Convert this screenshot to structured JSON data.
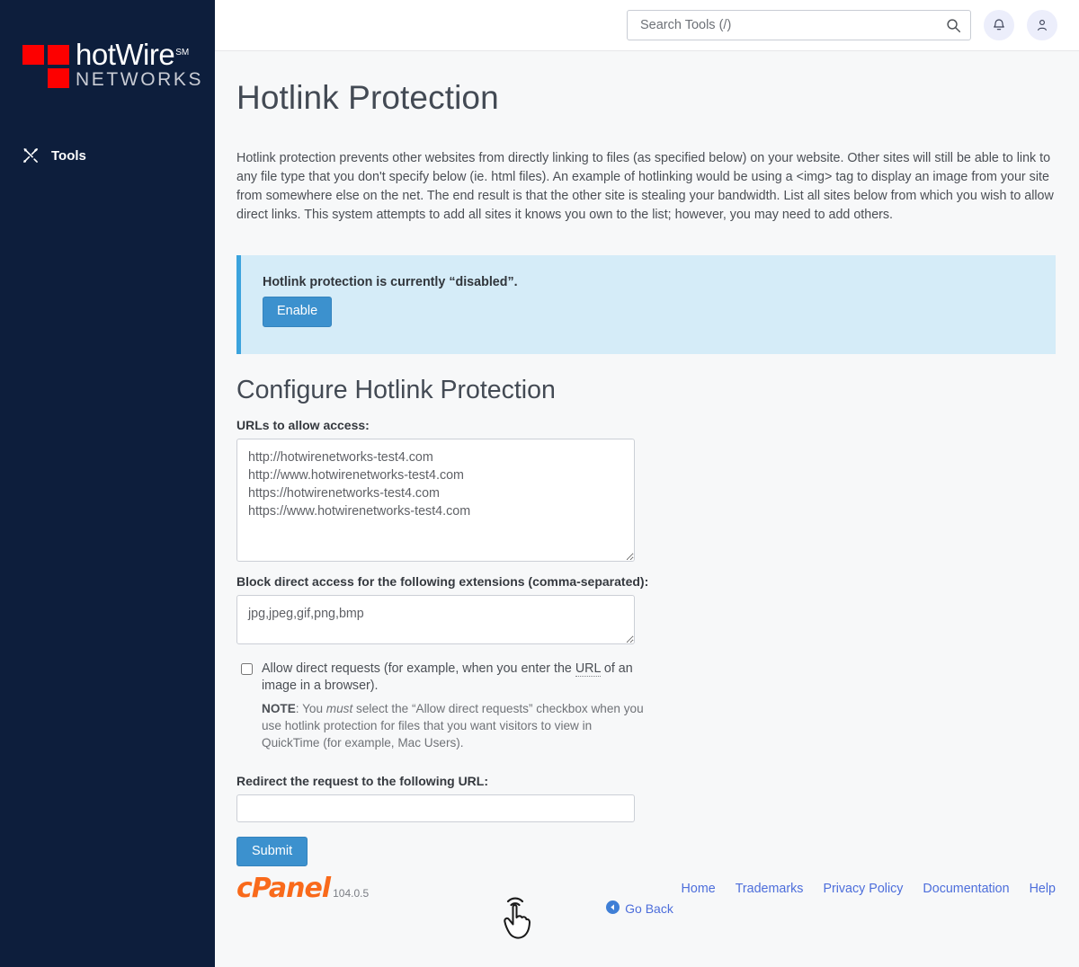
{
  "sidebar": {
    "logo": {
      "line1": "hotWire",
      "superscript": "SM",
      "line2": "NETWORKS",
      "square_color": "#fd0000",
      "background": "#0d1e3c"
    },
    "nav": [
      {
        "label": "Tools",
        "icon": "tools-icon"
      }
    ]
  },
  "topbar": {
    "search": {
      "placeholder": "Search Tools (/)",
      "value": "",
      "icon": "search-icon"
    },
    "notifications_icon": "bell-icon",
    "account_icon": "user-icon"
  },
  "page": {
    "title": "Hotlink Protection",
    "intro": "Hotlink protection prevents other websites from directly linking to files (as specified below) on your website. Other sites will still be able to link to any file type that you don't specify below (ie. html files). An example of hotlinking would be using a <img> tag to display an image from your site from somewhere else on the net. The end result is that the other site is stealing your bandwidth. List all sites below from which you wish to allow direct links. This system attempts to add all sites it knows you own to the list; however, you may need to add others."
  },
  "alert": {
    "message": "Hotlink protection is currently “disabled”.",
    "button_label": "Enable",
    "background": "#d5ecf8",
    "border_color": "#3ba3dd",
    "button_color": "#3c91ce"
  },
  "form": {
    "heading": "Configure Hotlink Protection",
    "urls_label": "URLs to allow access:",
    "urls_value": "http://hotwirenetworks-test4.com\nhttp://www.hotwirenetworks-test4.com\nhttps://hotwirenetworks-test4.com\nhttps://www.hotwirenetworks-test4.com",
    "extensions_label": "Block direct access for the following extensions (comma-separated):",
    "extensions_value": "jpg,jpeg,gif,png,bmp",
    "allow_direct": {
      "checked": false,
      "text_before": "Allow direct requests (for example, when you enter the ",
      "abbr": "URL",
      "text_after": " of an image in a browser).",
      "note_label": "NOTE",
      "note_part1": ": You ",
      "note_emphasis": "must",
      "note_part2": " select the “Allow direct requests” checkbox when you use hotlink protection for files that you want visitors to view in QuickTime (for example, Mac Users)."
    },
    "redirect_label": "Redirect the request to the following URL:",
    "redirect_value": "",
    "submit_label": "Submit"
  },
  "go_back": {
    "label": "Go Back",
    "icon": "arrow-circle-left-icon"
  },
  "footer": {
    "brand": "cPanel",
    "version": "104.0.5",
    "brand_color": "#f96a1b",
    "links": [
      {
        "label": "Home"
      },
      {
        "label": "Trademarks"
      },
      {
        "label": "Privacy Policy"
      },
      {
        "label": "Documentation"
      },
      {
        "label": "Help"
      }
    ]
  },
  "cursor": {
    "type": "pointing-hand-click"
  }
}
